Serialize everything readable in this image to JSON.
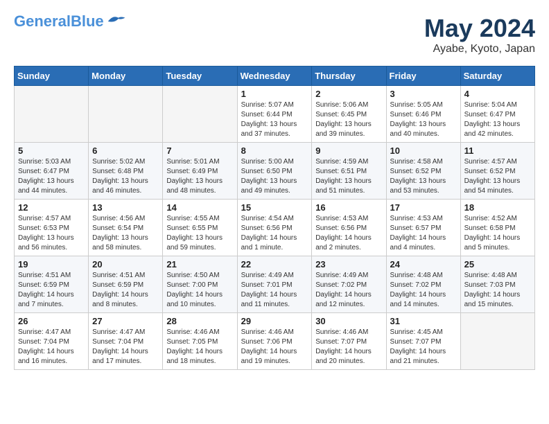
{
  "header": {
    "logo_line1": "General",
    "logo_line2": "Blue",
    "month_title": "May 2024",
    "location": "Ayabe, Kyoto, Japan"
  },
  "weekdays": [
    "Sunday",
    "Monday",
    "Tuesday",
    "Wednesday",
    "Thursday",
    "Friday",
    "Saturday"
  ],
  "weeks": [
    [
      {
        "day": "",
        "info": ""
      },
      {
        "day": "",
        "info": ""
      },
      {
        "day": "",
        "info": ""
      },
      {
        "day": "1",
        "info": "Sunrise: 5:07 AM\nSunset: 6:44 PM\nDaylight: 13 hours\nand 37 minutes."
      },
      {
        "day": "2",
        "info": "Sunrise: 5:06 AM\nSunset: 6:45 PM\nDaylight: 13 hours\nand 39 minutes."
      },
      {
        "day": "3",
        "info": "Sunrise: 5:05 AM\nSunset: 6:46 PM\nDaylight: 13 hours\nand 40 minutes."
      },
      {
        "day": "4",
        "info": "Sunrise: 5:04 AM\nSunset: 6:47 PM\nDaylight: 13 hours\nand 42 minutes."
      }
    ],
    [
      {
        "day": "5",
        "info": "Sunrise: 5:03 AM\nSunset: 6:47 PM\nDaylight: 13 hours\nand 44 minutes."
      },
      {
        "day": "6",
        "info": "Sunrise: 5:02 AM\nSunset: 6:48 PM\nDaylight: 13 hours\nand 46 minutes."
      },
      {
        "day": "7",
        "info": "Sunrise: 5:01 AM\nSunset: 6:49 PM\nDaylight: 13 hours\nand 48 minutes."
      },
      {
        "day": "8",
        "info": "Sunrise: 5:00 AM\nSunset: 6:50 PM\nDaylight: 13 hours\nand 49 minutes."
      },
      {
        "day": "9",
        "info": "Sunrise: 4:59 AM\nSunset: 6:51 PM\nDaylight: 13 hours\nand 51 minutes."
      },
      {
        "day": "10",
        "info": "Sunrise: 4:58 AM\nSunset: 6:52 PM\nDaylight: 13 hours\nand 53 minutes."
      },
      {
        "day": "11",
        "info": "Sunrise: 4:57 AM\nSunset: 6:52 PM\nDaylight: 13 hours\nand 54 minutes."
      }
    ],
    [
      {
        "day": "12",
        "info": "Sunrise: 4:57 AM\nSunset: 6:53 PM\nDaylight: 13 hours\nand 56 minutes."
      },
      {
        "day": "13",
        "info": "Sunrise: 4:56 AM\nSunset: 6:54 PM\nDaylight: 13 hours\nand 58 minutes."
      },
      {
        "day": "14",
        "info": "Sunrise: 4:55 AM\nSunset: 6:55 PM\nDaylight: 13 hours\nand 59 minutes."
      },
      {
        "day": "15",
        "info": "Sunrise: 4:54 AM\nSunset: 6:56 PM\nDaylight: 14 hours\nand 1 minute."
      },
      {
        "day": "16",
        "info": "Sunrise: 4:53 AM\nSunset: 6:56 PM\nDaylight: 14 hours\nand 2 minutes."
      },
      {
        "day": "17",
        "info": "Sunrise: 4:53 AM\nSunset: 6:57 PM\nDaylight: 14 hours\nand 4 minutes."
      },
      {
        "day": "18",
        "info": "Sunrise: 4:52 AM\nSunset: 6:58 PM\nDaylight: 14 hours\nand 5 minutes."
      }
    ],
    [
      {
        "day": "19",
        "info": "Sunrise: 4:51 AM\nSunset: 6:59 PM\nDaylight: 14 hours\nand 7 minutes."
      },
      {
        "day": "20",
        "info": "Sunrise: 4:51 AM\nSunset: 6:59 PM\nDaylight: 14 hours\nand 8 minutes."
      },
      {
        "day": "21",
        "info": "Sunrise: 4:50 AM\nSunset: 7:00 PM\nDaylight: 14 hours\nand 10 minutes."
      },
      {
        "day": "22",
        "info": "Sunrise: 4:49 AM\nSunset: 7:01 PM\nDaylight: 14 hours\nand 11 minutes."
      },
      {
        "day": "23",
        "info": "Sunrise: 4:49 AM\nSunset: 7:02 PM\nDaylight: 14 hours\nand 12 minutes."
      },
      {
        "day": "24",
        "info": "Sunrise: 4:48 AM\nSunset: 7:02 PM\nDaylight: 14 hours\nand 14 minutes."
      },
      {
        "day": "25",
        "info": "Sunrise: 4:48 AM\nSunset: 7:03 PM\nDaylight: 14 hours\nand 15 minutes."
      }
    ],
    [
      {
        "day": "26",
        "info": "Sunrise: 4:47 AM\nSunset: 7:04 PM\nDaylight: 14 hours\nand 16 minutes."
      },
      {
        "day": "27",
        "info": "Sunrise: 4:47 AM\nSunset: 7:04 PM\nDaylight: 14 hours\nand 17 minutes."
      },
      {
        "day": "28",
        "info": "Sunrise: 4:46 AM\nSunset: 7:05 PM\nDaylight: 14 hours\nand 18 minutes."
      },
      {
        "day": "29",
        "info": "Sunrise: 4:46 AM\nSunset: 7:06 PM\nDaylight: 14 hours\nand 19 minutes."
      },
      {
        "day": "30",
        "info": "Sunrise: 4:46 AM\nSunset: 7:07 PM\nDaylight: 14 hours\nand 20 minutes."
      },
      {
        "day": "31",
        "info": "Sunrise: 4:45 AM\nSunset: 7:07 PM\nDaylight: 14 hours\nand 21 minutes."
      },
      {
        "day": "",
        "info": ""
      }
    ]
  ]
}
